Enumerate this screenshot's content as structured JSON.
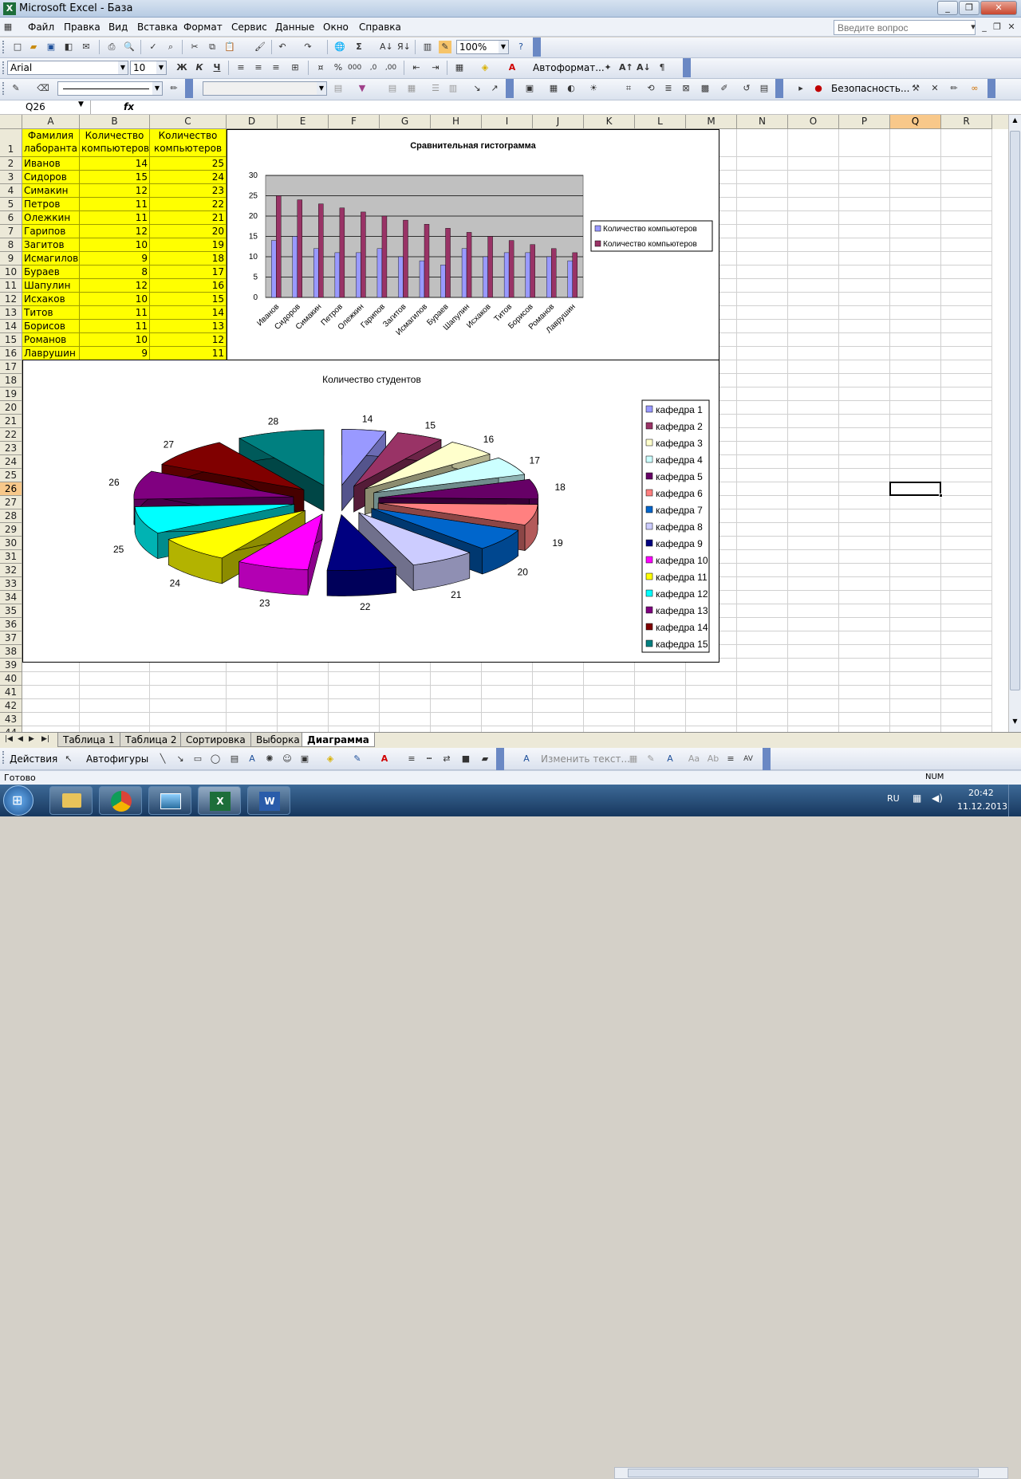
{
  "window": {
    "title": "Microsoft Excel - База",
    "icon": "excel-icon"
  },
  "menu": {
    "items": [
      "Файл",
      "Правка",
      "Вид",
      "Вставка",
      "Формат",
      "Сервис",
      "Данные",
      "Окно",
      "Справка"
    ],
    "ask_placeholder": "Введите вопрос"
  },
  "toolbar": {
    "zoom": "100%",
    "font": "Arial",
    "font_size": "10",
    "autoformat": "Автоформат...",
    "security": "Безопасность..."
  },
  "formula": {
    "name_box": "Q26",
    "fx": "fx",
    "value": ""
  },
  "columns": [
    "A",
    "B",
    "C",
    "D",
    "E",
    "F",
    "G",
    "H",
    "I",
    "J",
    "K",
    "L",
    "M",
    "N",
    "O",
    "P",
    "Q",
    "R"
  ],
  "selected_cell": "Q26",
  "table": {
    "headers": [
      "Фамилия лаборанта",
      "Количество компьютеров",
      "Количество компьютеров"
    ],
    "rows": [
      [
        "Иванов",
        "14",
        "25"
      ],
      [
        "Сидоров",
        "15",
        "24"
      ],
      [
        "Симакин",
        "12",
        "23"
      ],
      [
        "Петров",
        "11",
        "22"
      ],
      [
        "Олежкин",
        "11",
        "21"
      ],
      [
        "Гарипов",
        "12",
        "20"
      ],
      [
        "Загитов",
        "10",
        "19"
      ],
      [
        "Исмагилов",
        "9",
        "18"
      ],
      [
        "Бураев",
        "8",
        "17"
      ],
      [
        "Шапулин",
        "12",
        "16"
      ],
      [
        "Исхаков",
        "10",
        "15"
      ],
      [
        "Титов",
        "11",
        "14"
      ],
      [
        "Борисов",
        "11",
        "13"
      ],
      [
        "Романов",
        "10",
        "12"
      ],
      [
        "Лаврушин",
        "9",
        "11"
      ]
    ]
  },
  "chart_data": [
    {
      "type": "bar",
      "title": "Сравнительная гистограмма",
      "categories": [
        "Иванов",
        "Сидоров",
        "Симакин",
        "Петров",
        "Олежкин",
        "Гарипов",
        "Загитов",
        "Исмагилов",
        "Бураев",
        "Шапулин",
        "Исхаков",
        "Титов",
        "Борисов",
        "Романов",
        "Лаврушин"
      ],
      "series": [
        {
          "name": "Количество компьютеров",
          "values": [
            14,
            15,
            12,
            11,
            11,
            12,
            10,
            9,
            8,
            12,
            10,
            11,
            11,
            10,
            9
          ],
          "color": "#9999ff"
        },
        {
          "name": "Количество компьютеров",
          "values": [
            25,
            24,
            23,
            22,
            21,
            20,
            19,
            18,
            17,
            16,
            15,
            14,
            13,
            12,
            11
          ],
          "color": "#993366"
        }
      ],
      "ylim": [
        0,
        30
      ],
      "yticks": [
        "0",
        "5",
        "10",
        "15",
        "20",
        "25",
        "30"
      ],
      "grid": true,
      "plot_background": "#c0c0c0",
      "legend": "right"
    },
    {
      "type": "pie",
      "title": "Количество студентов",
      "labels": [
        "кафедра 1",
        "кафедра 2",
        "кафедра 3",
        "кафедра 4",
        "кафедра 5",
        "кафедра 6",
        "кафедра 7",
        "кафедра 8",
        "кафедра 9",
        "кафедра 10",
        "кафедра 11",
        "кафедра 12",
        "кафедра 13",
        "кафедра 14",
        "кафедра 15"
      ],
      "values": [
        14,
        15,
        16,
        17,
        18,
        19,
        20,
        21,
        22,
        23,
        24,
        25,
        26,
        27,
        28
      ],
      "value_labels": [
        "14",
        "15",
        "16",
        "17",
        "18",
        "19",
        "20",
        "21",
        "22",
        "23",
        "24",
        "25",
        "26",
        "27",
        "28"
      ],
      "colors": [
        "#9999ff",
        "#993366",
        "#ffffcc",
        "#ccffff",
        "#660066",
        "#ff8080",
        "#0066cc",
        "#ccccff",
        "#000080",
        "#ff00ff",
        "#ffff00",
        "#00ffff",
        "#800080",
        "#800000",
        "#008080"
      ],
      "exploded": true,
      "legend": "right"
    }
  ],
  "sheet_tabs": {
    "tabs": [
      "Таблица 1",
      "Таблица 2",
      "Сортировка",
      "Выборка",
      "Диаграмма"
    ],
    "active": "Диаграмма"
  },
  "drawing": {
    "actions": "Действия",
    "autoshapes": "Автофигуры",
    "edit_text": "Изменить текст..."
  },
  "status": {
    "ready": "Готово",
    "num": "NUM"
  },
  "taskbar": {
    "lang": "RU",
    "time": "20:42",
    "date": "11.12.2013"
  }
}
